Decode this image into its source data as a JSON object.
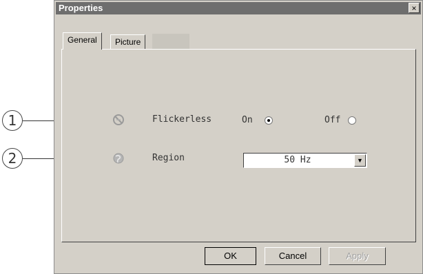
{
  "callouts": [
    "1",
    "2"
  ],
  "window": {
    "title": "Properties",
    "close_label": "×"
  },
  "tabs": [
    {
      "label": "General",
      "active": true
    },
    {
      "label": "Picture",
      "active": false
    }
  ],
  "flicker": {
    "icon": "flicker-icon",
    "label": "Flickerless",
    "on_label": "On",
    "off_label": "Off",
    "selected": "On"
  },
  "region": {
    "icon": "globe-icon",
    "label": "Region",
    "value": "50 Hz"
  },
  "buttons": {
    "ok": "OK",
    "cancel": "Cancel",
    "apply": "Apply"
  }
}
